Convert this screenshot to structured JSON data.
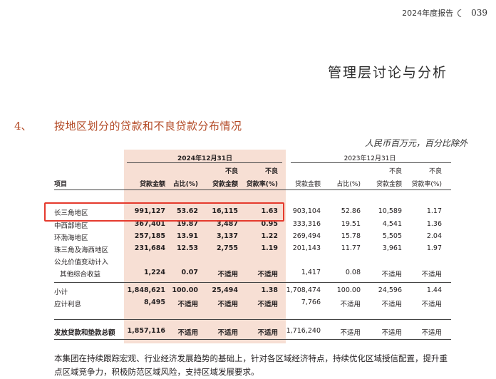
{
  "header": {
    "report": "2024年度报告",
    "page": "039"
  },
  "section_title": "管理层讨论与分析",
  "heading": {
    "number": "4、",
    "text": "按地区划分的贷款和不良贷款分布情况"
  },
  "unit_note": "人民币百万元，百分比除外",
  "table": {
    "year_2024": "2024年12月31日",
    "year_2023": "2023年12月31日",
    "col_item": "项目",
    "col_loans": "贷款金额",
    "col_pct": "占比(%)",
    "col_npl_top": "不良",
    "col_npl_bottom": "贷款金额",
    "col_nplr_top": "不良",
    "col_nplr_bottom": "贷款率(%)",
    "rows": [
      {
        "label": "长三角地区",
        "v": [
          "991,127",
          "53.62",
          "16,115",
          "1.63",
          "903,104",
          "52.86",
          "10,589",
          "1.17"
        ]
      },
      {
        "label": "中西部地区",
        "v": [
          "367,401",
          "19.87",
          "3,487",
          "0.95",
          "333,316",
          "19.51",
          "4,541",
          "1.36"
        ]
      },
      {
        "label": "环渤海地区",
        "v": [
          "257,185",
          "13.91",
          "3,137",
          "1.22",
          "269,494",
          "15.78",
          "5,505",
          "2.04"
        ]
      },
      {
        "label": "珠三角及海西地区",
        "v": [
          "231,684",
          "12.53",
          "2,755",
          "1.19",
          "201,143",
          "11.77",
          "3,961",
          "1.97"
        ]
      },
      {
        "label": "公允价值变动计入",
        "v": [
          "",
          "",
          "",
          "",
          "",
          "",
          "",
          ""
        ]
      },
      {
        "label": "其他综合收益",
        "v": [
          "1,224",
          "0.07",
          "不适用",
          "不适用",
          "1,417",
          "0.08",
          "不适用",
          "不适用"
        ]
      },
      {
        "label": "小计",
        "v": [
          "1,848,621",
          "100.00",
          "25,494",
          "1.38",
          "1,708,474",
          "100.00",
          "24,596",
          "1.44"
        ]
      },
      {
        "label": "应计利息",
        "v": [
          "8,495",
          "不适用",
          "不适用",
          "不适用",
          "7,766",
          "不适用",
          "不适用",
          "不适用"
        ]
      },
      {
        "label": "发放贷款和垫款总额",
        "v": [
          "1,857,116",
          "不适用",
          "不适用",
          "不适用",
          "1,716,240",
          "不适用",
          "不适用",
          "不适用"
        ]
      }
    ]
  },
  "paragraph": "本集团在持续跟踪宏观、行业经济发展趋势的基础上，针对各区域经济特点，持续优化区域授信配置，提升重点区域竞争力，积极防范区域风险，支持区域发展要求。",
  "colors": {
    "accent": "#b34a26",
    "shade": "#f7dfd4",
    "highlight": "#e53a2d"
  }
}
